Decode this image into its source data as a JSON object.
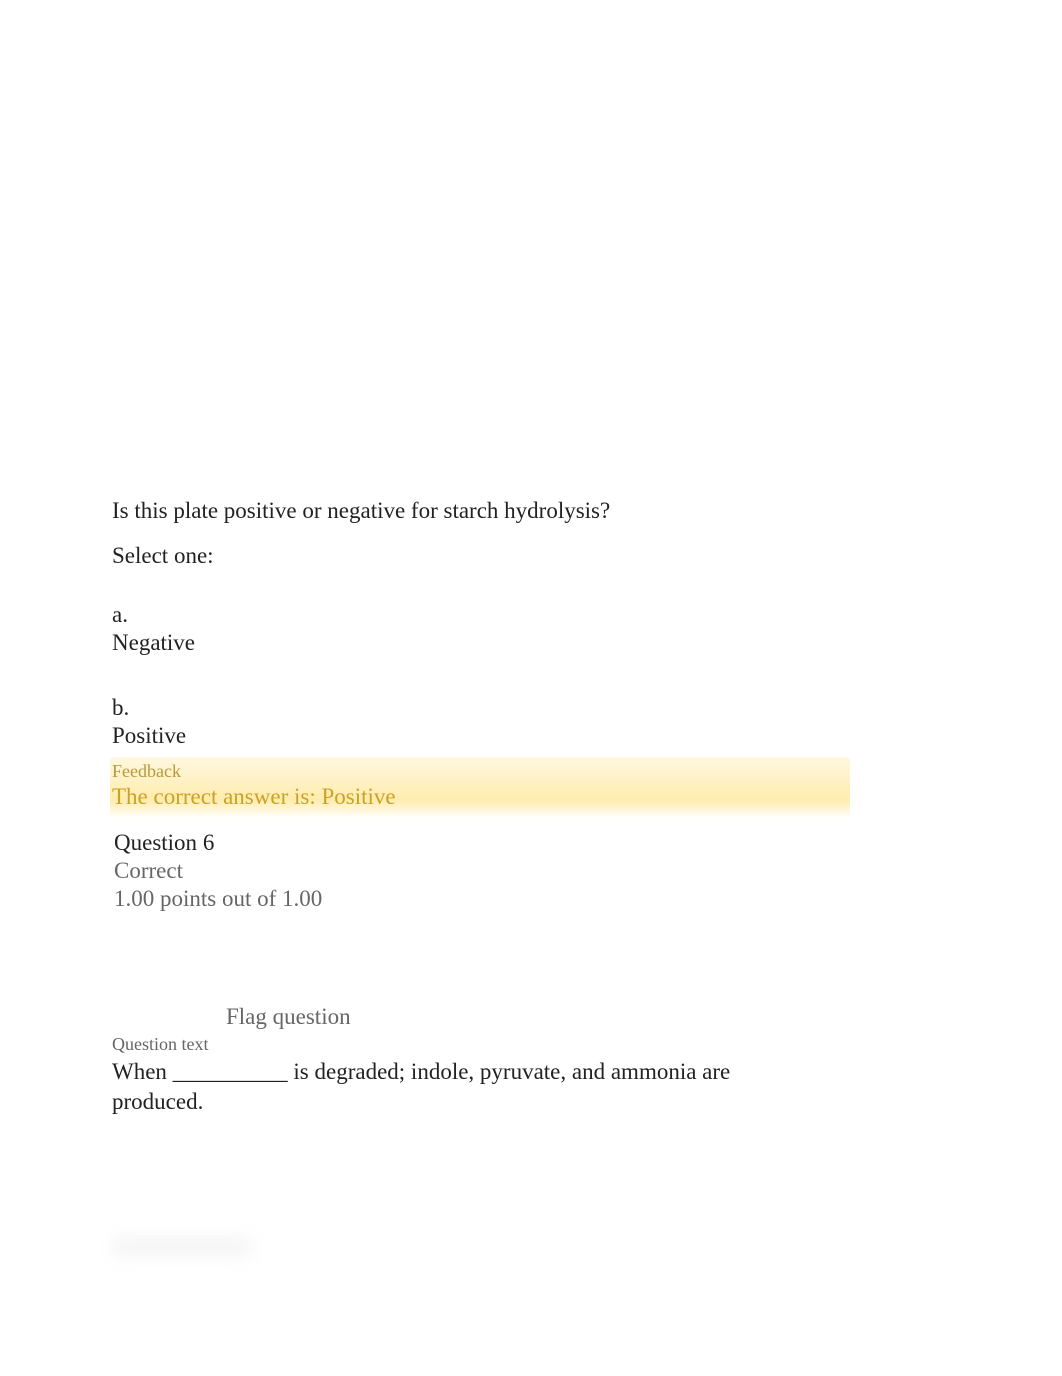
{
  "q5": {
    "prompt": "Is this plate positive or negative for starch hydrolysis?",
    "select_one": "Select one:",
    "options": [
      {
        "letter": "a.",
        "label": "Negative"
      },
      {
        "letter": "b.",
        "label": "Positive"
      }
    ],
    "feedback": {
      "label": "Feedback",
      "answer": "The correct answer is: Positive"
    }
  },
  "q6": {
    "number_prefix": "Question ",
    "number_value": "6",
    "status": "Correct",
    "points": "1.00 points out of 1.00",
    "flag": "Flag question",
    "text_label": "Question text",
    "prompt": "When __________ is degraded; indole, pyruvate, and ammonia are produced."
  }
}
